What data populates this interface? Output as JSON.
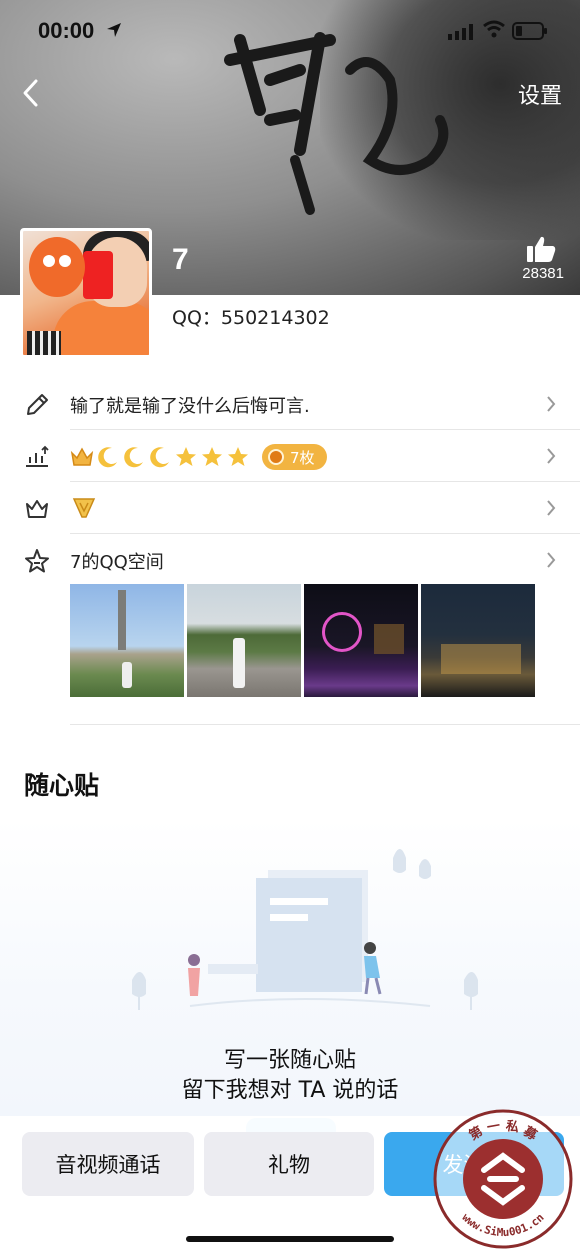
{
  "status_bar": {
    "time": "00:00"
  },
  "header": {
    "settings_label": "设置",
    "nickname": "7",
    "like_count": "28381",
    "qq_label": "QQ：550214302"
  },
  "rows": {
    "signature": "输了就是输了没什么后悔可言.",
    "level_badge": "7枚",
    "space_title": "7的QQ空间"
  },
  "sticky": {
    "title": "随心贴",
    "line1": "写一张随心贴",
    "line2": "留下我想对 TA 说的话"
  },
  "actions": {
    "call": "音视频通话",
    "gift": "礼物",
    "message": "发消息"
  },
  "watermark": {
    "top_text": "第 一 私 募",
    "bottom_text": "www.SiMu001.cn"
  },
  "colors": {
    "accent": "#3aa8ee",
    "badge": "#f2b441",
    "secondary_button": "#ececf1"
  }
}
